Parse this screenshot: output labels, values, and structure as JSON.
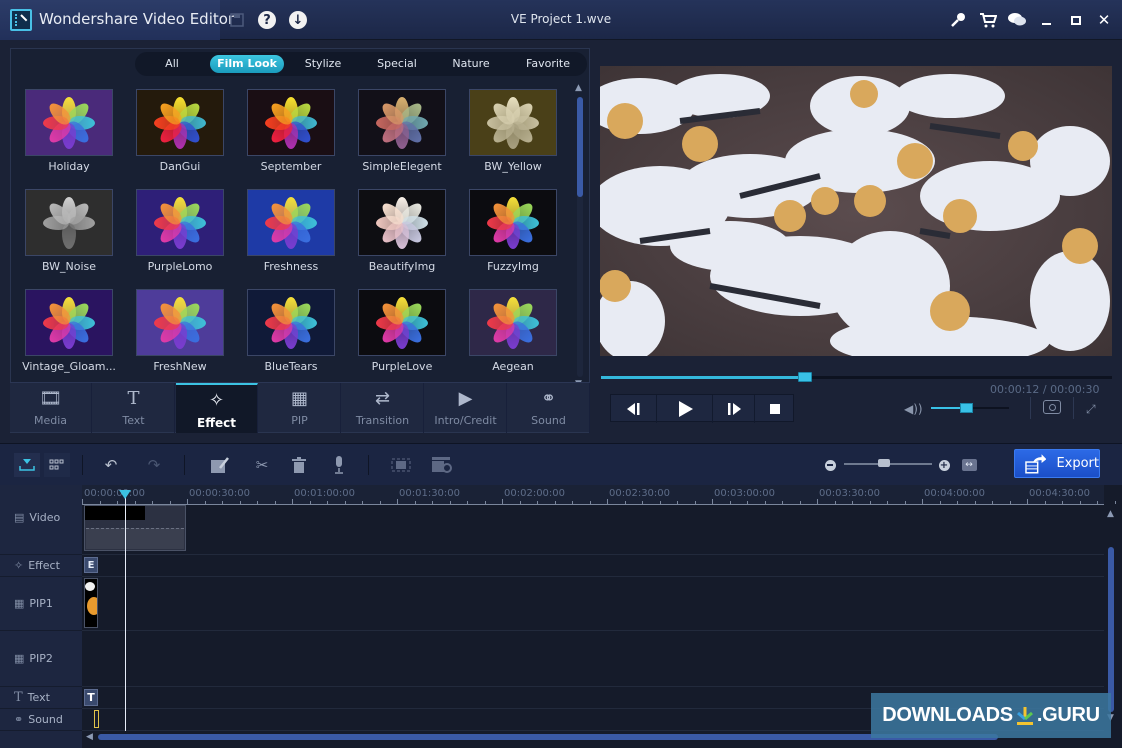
{
  "titlebar": {
    "app_title": "Wondershare Video Editor",
    "project_title": "VE Project 1.wve",
    "icons": [
      "save-icon",
      "help-icon",
      "download-icon",
      "key-icon",
      "cart-icon",
      "chat-icon",
      "minimize-icon",
      "maximize-icon",
      "close-icon"
    ]
  },
  "categories": [
    {
      "label": "All",
      "active": false
    },
    {
      "label": "Film Look",
      "active": true
    },
    {
      "label": "Stylize",
      "active": false
    },
    {
      "label": "Special",
      "active": false
    },
    {
      "label": "Nature",
      "active": false
    },
    {
      "label": "Favorite",
      "active": false
    }
  ],
  "effects": [
    {
      "name": "Holiday",
      "bg": "#4a2a7a",
      "tone": "full"
    },
    {
      "name": "DanGui",
      "bg": "#241a0c",
      "tone": "warm"
    },
    {
      "name": "September",
      "bg": "#1a0e14",
      "tone": "warm"
    },
    {
      "name": "SimpleElegent",
      "bg": "#121018",
      "tone": "muted"
    },
    {
      "name": "BW_Yellow",
      "bg": "#4a4018",
      "tone": "sepia"
    },
    {
      "name": "BW_Noise",
      "bg": "#2e2e2e",
      "tone": "gray"
    },
    {
      "name": "PurpleLomo",
      "bg": "#2e1f78",
      "tone": "full"
    },
    {
      "name": "Freshness",
      "bg": "#1e3aa6",
      "tone": "full"
    },
    {
      "name": "BeautifyImg",
      "bg": "#0e0e12",
      "tone": "pale"
    },
    {
      "name": "FuzzyImg",
      "bg": "#0c0c10",
      "tone": "full"
    },
    {
      "name": "Vintage_Gloam...",
      "bg": "#2a1460",
      "tone": "full"
    },
    {
      "name": "FreshNew",
      "bg": "#4e3c9a",
      "tone": "full"
    },
    {
      "name": "BlueTears",
      "bg": "#101a38",
      "tone": "full"
    },
    {
      "name": "PurpleLove",
      "bg": "#0c0c10",
      "tone": "full"
    },
    {
      "name": "Aegean",
      "bg": "#2e2848",
      "tone": "full"
    }
  ],
  "media_tabs": [
    {
      "label": "Media",
      "icon": "media-icon",
      "active": false
    },
    {
      "label": "Text",
      "icon": "text-icon",
      "active": false
    },
    {
      "label": "Effect",
      "icon": "magic-wand-icon",
      "active": true
    },
    {
      "label": "PIP",
      "icon": "pip-icon",
      "active": false
    },
    {
      "label": "Transition",
      "icon": "transition-icon",
      "active": false
    },
    {
      "label": "Intro/Credit",
      "icon": "intro-credit-icon",
      "active": false
    },
    {
      "label": "Sound",
      "icon": "headphones-icon",
      "active": false
    }
  ],
  "player": {
    "current_time": "00:00:12",
    "total_time": "00:00:30",
    "time_readout": "00:00:12 / 00:00:30",
    "progress": 0.4,
    "volume": 0.45
  },
  "timeline_toolbar": {
    "export_label": "Export",
    "zoom_level": 0.45
  },
  "ruler": [
    "00:00:00:00",
    "00:00:30:00",
    "00:01:00:00",
    "00:01:30:00",
    "00:02:00:00",
    "00:02:30:00",
    "00:03:00:00",
    "00:03:30:00",
    "00:04:00:00",
    "00:04:30:00"
  ],
  "tracks": [
    {
      "label": "Video",
      "icon": "film-icon"
    },
    {
      "label": "Effect",
      "icon": "magic-wand-icon"
    },
    {
      "label": "PIP1",
      "icon": "pip-icon"
    },
    {
      "label": "PIP2",
      "icon": "pip-icon"
    },
    {
      "label": "Text",
      "icon": "text-icon"
    },
    {
      "label": "Sound",
      "icon": "headphones-icon"
    }
  ],
  "clips": {
    "effect_badge": "E",
    "text_badge": "T"
  },
  "watermark": {
    "left": "DOWNLOADS",
    "right": ".GURU"
  },
  "colors": {
    "accent": "#3cc3e3",
    "export": "#2560de",
    "panel": "#182033"
  }
}
